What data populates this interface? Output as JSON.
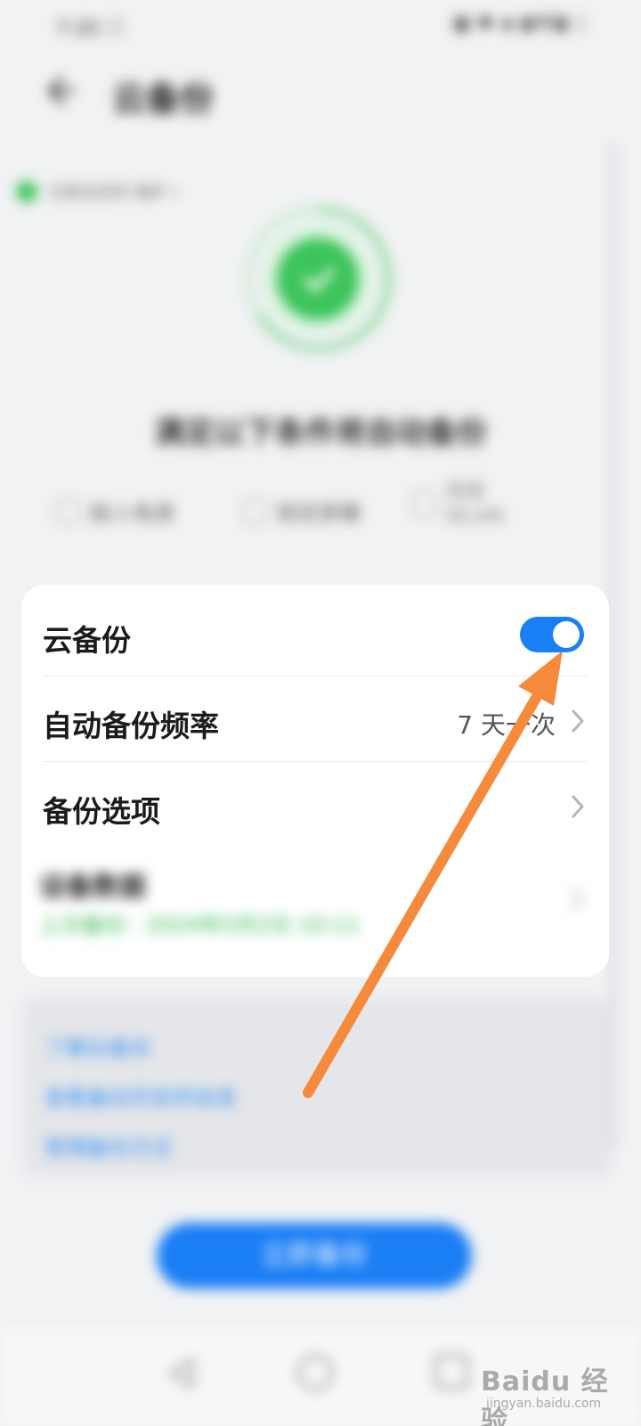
{
  "status_bar": {
    "left": "7:20 ⓘ",
    "right": "▣ ✱ ◈ ▮46▮ ⎍"
  },
  "header": {
    "title": "云备份"
  },
  "protect_tag": {
    "text": "已受云空间 保护 〉"
  },
  "status_ring": {
    "color": "#3cc45a"
  },
  "headline": "满足以下条件将自动备份",
  "conditions": [
    {
      "label": "接入电源"
    },
    {
      "label": "锁定屏幕"
    },
    {
      "label_line1": "连接",
      "label_line2": "WLAN"
    }
  ],
  "settings_card": {
    "rows": [
      {
        "label": "云备份",
        "toggle_on": true
      },
      {
        "label": "自动备份频率",
        "value": "7 天一次"
      },
      {
        "label": "备份选项"
      }
    ],
    "blurred_row": {
      "title": "设备数据",
      "subtitle": "上次备份：2024年5月2日 10:11"
    }
  },
  "info_links": [
    "了解云备份",
    "查看备份历史的信息",
    "管理备份方式"
  ],
  "primary_button": {
    "label": "立即备份"
  },
  "watermark": {
    "main": "Baidu 经验",
    "sub": "jingyan.baidu.com"
  },
  "colors": {
    "accent": "#1a7ef5",
    "success": "#3cc45a",
    "annotation_arrow": "#f58a3c"
  }
}
